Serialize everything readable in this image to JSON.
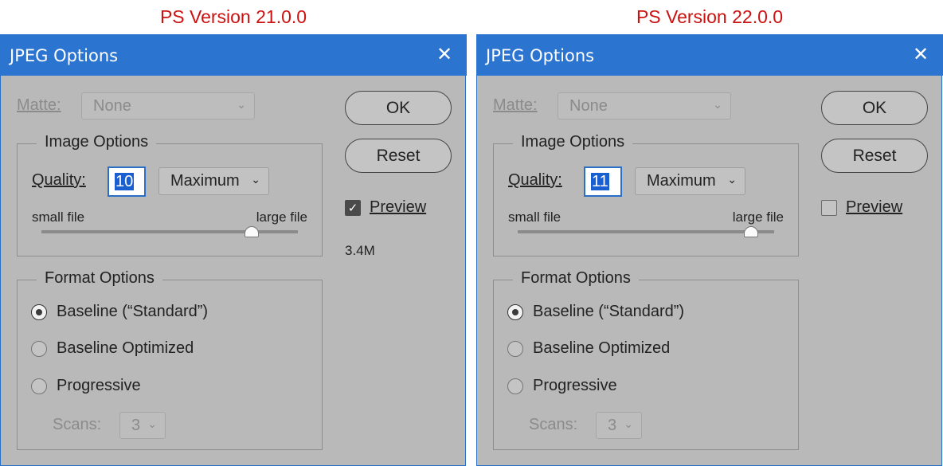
{
  "captions": {
    "left": "PS Version 21.0.0",
    "right": "PS Version 22.0.0"
  },
  "dialogs": [
    {
      "title": "JPEG Options",
      "close_glyph": "✕",
      "matte_label": "Matte:",
      "matte_value": "None",
      "image_options_title": "Image Options",
      "quality_label": "Quality:",
      "quality_value": "10",
      "quality_preset": "Maximum",
      "small_file": "small file",
      "large_file": "large file",
      "slider_fraction": 0.82,
      "format_options_title": "Format Options",
      "format_baseline": "Baseline (“Standard”)",
      "format_optimized": "Baseline Optimized",
      "format_progressive": "Progressive",
      "format_selected": "baseline",
      "scans_label": "Scans:",
      "scans_value": "3",
      "ok_label": "OK",
      "reset_label": "Reset",
      "preview_label": "Preview",
      "preview_checked": true,
      "file_size": "3.4M"
    },
    {
      "title": "JPEG Options",
      "close_glyph": "✕",
      "matte_label": "Matte:",
      "matte_value": "None",
      "image_options_title": "Image Options",
      "quality_label": "Quality:",
      "quality_value": "11",
      "quality_preset": "Maximum",
      "small_file": "small file",
      "large_file": "large file",
      "slider_fraction": 0.91,
      "format_options_title": "Format Options",
      "format_baseline": "Baseline (“Standard”)",
      "format_optimized": "Baseline Optimized",
      "format_progressive": "Progressive",
      "format_selected": "baseline",
      "scans_label": "Scans:",
      "scans_value": "3",
      "ok_label": "OK",
      "reset_label": "Reset",
      "preview_label": "Preview",
      "preview_checked": false,
      "file_size": ""
    }
  ],
  "colors": {
    "caption": "#cc1111",
    "titlebar": "#2b74d0",
    "dialog_bg": "#b9b9b9",
    "selection": "#1a5fd0"
  },
  "icons": {
    "close": "close-icon",
    "chevron": "chevron-down-icon",
    "check": "checkmark-icon"
  }
}
